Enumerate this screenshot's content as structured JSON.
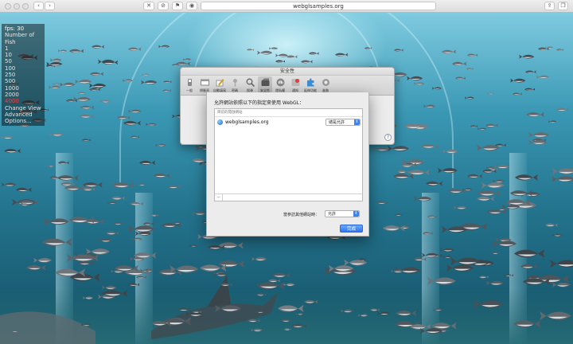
{
  "browser": {
    "url": "webglsamples.org",
    "colors": {
      "toolbar": "#e4e4e4",
      "accent": "#3b82f0"
    }
  },
  "stats": {
    "fps_label": "fps: 30",
    "fish_label": "Number of Fish",
    "fish_options": [
      "1",
      "10",
      "50",
      "100",
      "250",
      "500",
      "1000",
      "2000",
      "4000"
    ],
    "selected_option": "4000",
    "menu": [
      "Change View",
      "Advanced",
      "Options..."
    ]
  },
  "prefs": {
    "title": "安全性",
    "tabs": [
      {
        "label": "一般",
        "icon": "switch-icon"
      },
      {
        "label": "標籤頁",
        "icon": "tabs-icon"
      },
      {
        "label": "自動填寫",
        "icon": "pencil-icon"
      },
      {
        "label": "密碼",
        "icon": "key-icon"
      },
      {
        "label": "搜尋",
        "icon": "search-icon"
      },
      {
        "label": "安全性",
        "icon": "lock-icon"
      },
      {
        "label": "隱私權",
        "icon": "hand-icon"
      },
      {
        "label": "通知",
        "icon": "notification-icon"
      },
      {
        "label": "延伸功能",
        "icon": "puzzle-icon"
      },
      {
        "label": "進階",
        "icon": "gear-icon"
      }
    ],
    "active_tab": 5
  },
  "webgl_sheet": {
    "heading": "允許網站依照以下的指定來使用 WebGL：",
    "list_header": "目前的開啟網站",
    "sites": [
      {
        "name": "webglsamples.org",
        "policy": "總是允許"
      }
    ],
    "other_label": "當參訪其他網站時：",
    "other_value": "允許",
    "done_label": "完成"
  }
}
